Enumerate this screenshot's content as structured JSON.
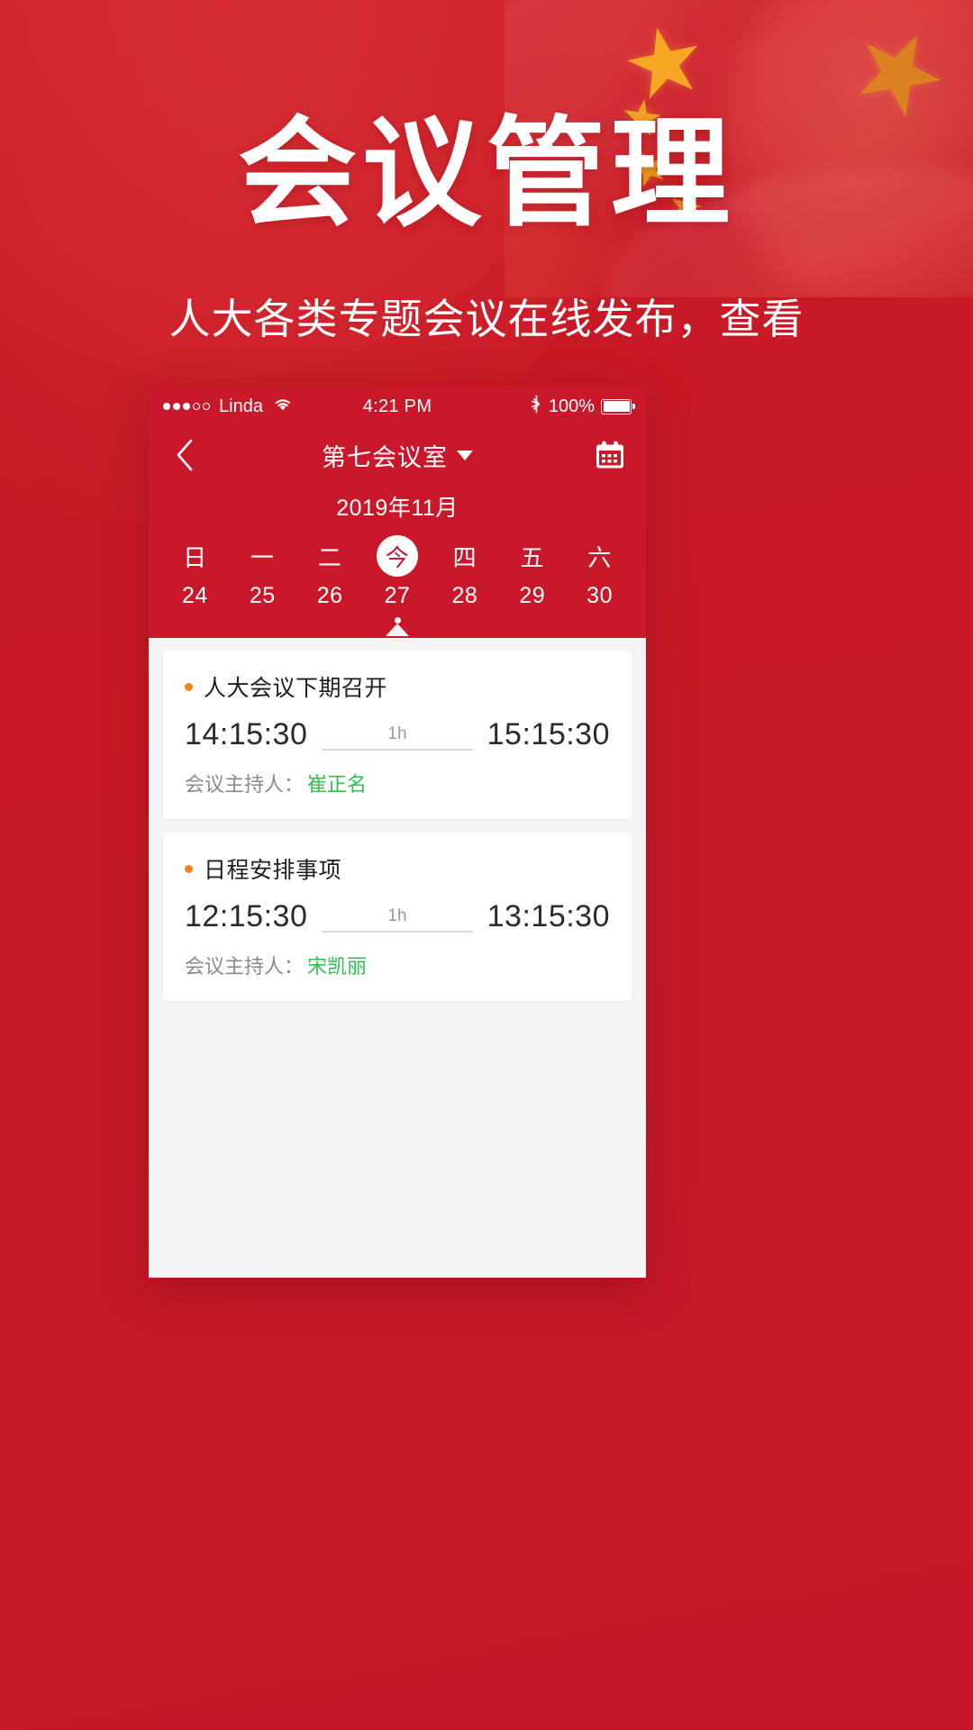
{
  "poster": {
    "headline": "会议管理",
    "subheadline": "人大各类专题会议在线发布，查看",
    "brand_red": "#c9182a",
    "accent_orange": "#f5821f",
    "accent_green": "#2ec04c",
    "flag_star_color": "#f5a623"
  },
  "phone": {
    "statusbar": {
      "carrier": "Linda",
      "signal_dots_filled": 3,
      "signal_dots_empty": 2,
      "wifi_icon": "wifi-icon",
      "time": "4:21 PM",
      "bluetooth_icon": "bluetooth-icon",
      "battery_percent": "100%",
      "battery_icon": "battery-full-icon"
    },
    "navbar": {
      "back_icon": "chevron-left-icon",
      "title": "第七会议室",
      "dropdown_icon": "chevron-down-icon",
      "calendar_icon": "calendar-icon"
    },
    "calendar": {
      "month_label": "2019年11月",
      "days": [
        {
          "dow": "日",
          "date": "24",
          "today": false
        },
        {
          "dow": "一",
          "date": "25",
          "today": false
        },
        {
          "dow": "二",
          "date": "26",
          "today": false
        },
        {
          "dow": "今",
          "date": "27",
          "today": true
        },
        {
          "dow": "四",
          "date": "28",
          "today": false
        },
        {
          "dow": "五",
          "date": "29",
          "today": false
        },
        {
          "dow": "六",
          "date": "30",
          "today": false
        }
      ]
    },
    "meetings": [
      {
        "title": "人大会议下期召开",
        "start_time": "14:15:30",
        "duration": "1h",
        "end_time": "15:15:30",
        "host_label": "会议主持人：",
        "host_name": "崔正名"
      },
      {
        "title": "日程安排事项",
        "start_time": "12:15:30",
        "duration": "1h",
        "end_time": "13:15:30",
        "host_label": "会议主持人：",
        "host_name": "宋凯丽"
      }
    ]
  }
}
